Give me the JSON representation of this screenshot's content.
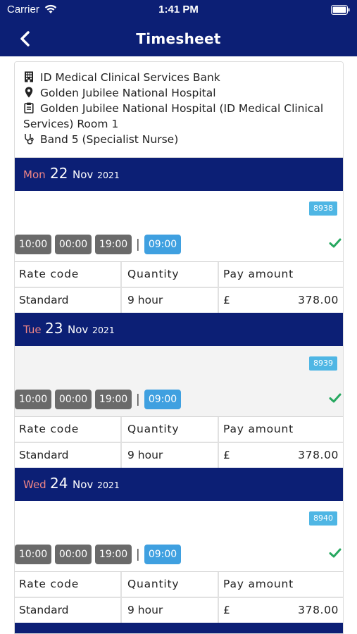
{
  "status_bar": {
    "carrier": "Carrier",
    "time": "1:41 PM"
  },
  "nav": {
    "title": "Timesheet"
  },
  "header": {
    "organisation": "ID Medical Clinical Services Bank",
    "location": "Golden Jubilee National Hospital",
    "department_line1": "Golden Jubilee National Hospital (ID Medical Clinical",
    "department_line2": "Services) Room  1",
    "band": "Band 5 (Specialist Nurse)"
  },
  "table_headers": {
    "rate_code": "Rate code",
    "quantity": "Quantity",
    "pay_amount": "Pay amount"
  },
  "days": [
    {
      "weekday": "Mon",
      "day": "22",
      "month": "Nov",
      "year": "2021",
      "ref": "8938",
      "start": "10:00",
      "break": "00:00",
      "end": "19:00",
      "separator": "|",
      "total": "09:00",
      "rate_code": "Standard",
      "quantity": "9 hour",
      "currency": "£",
      "amount": "378.00"
    },
    {
      "weekday": "Tue",
      "day": "23",
      "month": "Nov",
      "year": "2021",
      "ref": "8939",
      "start": "10:00",
      "break": "00:00",
      "end": "19:00",
      "separator": "|",
      "total": "09:00",
      "rate_code": "Standard",
      "quantity": "9 hour",
      "currency": "£",
      "amount": "378.00"
    },
    {
      "weekday": "Wed",
      "day": "24",
      "month": "Nov",
      "year": "2021",
      "ref": "8940",
      "start": "10:00",
      "break": "00:00",
      "end": "19:00",
      "separator": "|",
      "total": "09:00",
      "rate_code": "Standard",
      "quantity": "9 hour",
      "currency": "£",
      "amount": "378.00"
    }
  ],
  "colors": {
    "nav_bg": "#0c1f75",
    "weekday": "#f08585",
    "badge": "#4fb6e4",
    "total_chip": "#3fa0e0",
    "chip": "#6a6a6a",
    "check": "#27a860"
  }
}
